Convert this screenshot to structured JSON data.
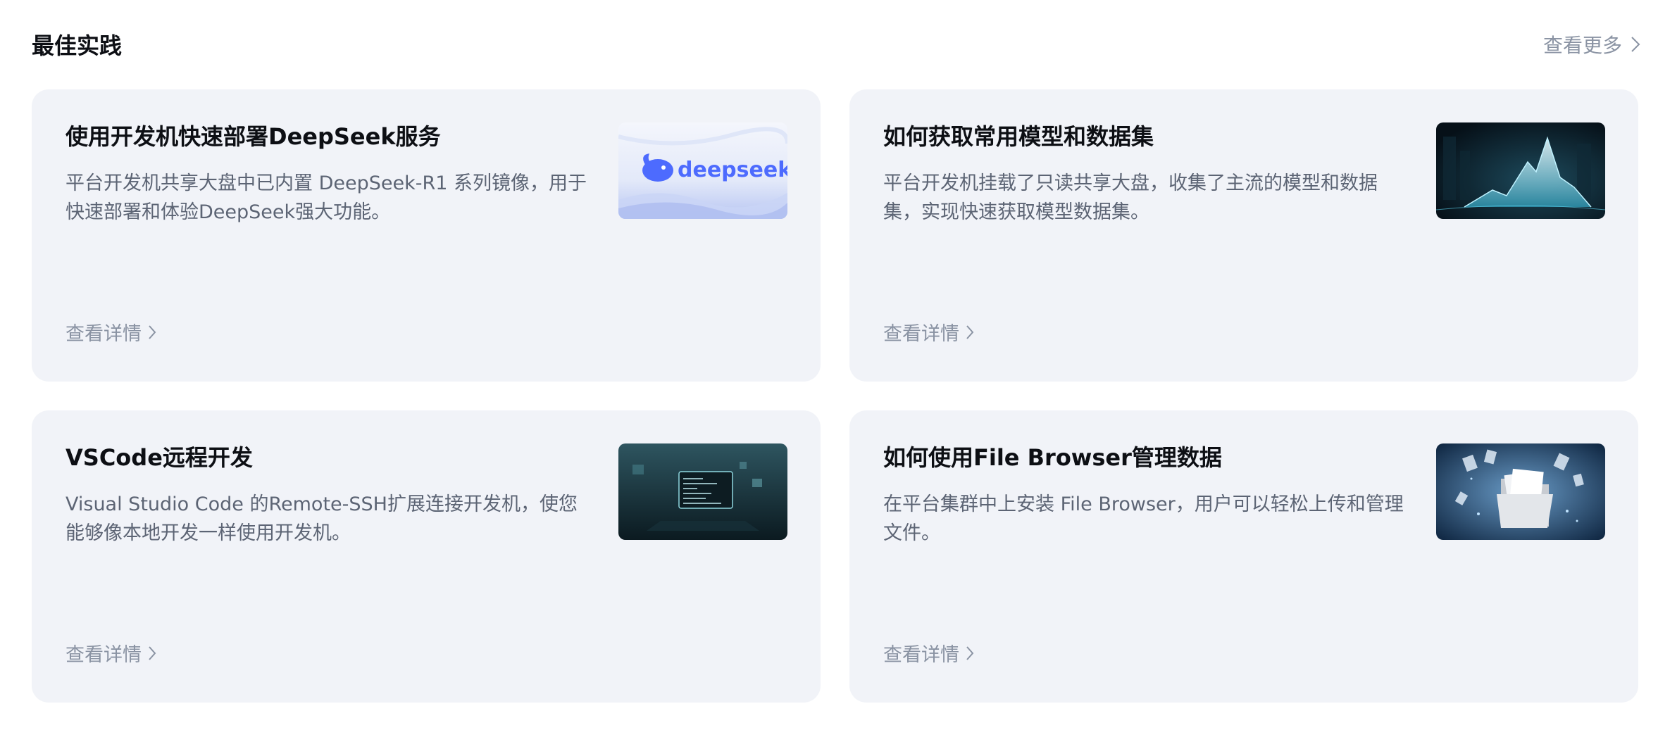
{
  "section": {
    "title": "最佳实践",
    "more_label": "查看更多"
  },
  "cards": [
    {
      "title": "使用开发机快速部署DeepSeek服务",
      "description": "平台开发机共享大盘中已内置 DeepSeek-R1 系列镜像，用于快速部署和体验DeepSeek强大功能。",
      "link_label": "查看详情",
      "thumb_icon": "deepseek-logo-thumbnail",
      "thumb_text": "deepseek"
    },
    {
      "title": "如何获取常用模型和数据集",
      "description": "平台开发机挂载了只读共享大盘，收集了主流的模型和数据集，实现快速获取模型数据集。",
      "link_label": "查看详情",
      "thumb_icon": "data-peaks-thumbnail"
    },
    {
      "title": "VSCode远程开发",
      "description": "Visual Studio Code 的Remote-SSH扩展连接开发机，使您能够像本地开发一样使用开发机。",
      "link_label": "查看详情",
      "thumb_icon": "code-screen-thumbnail"
    },
    {
      "title": "如何使用File Browser管理数据",
      "description": "在平台集群中上安装 File Browser，用户可以轻松上传和管理文件。",
      "link_label": "查看详情",
      "thumb_icon": "folder-files-thumbnail"
    }
  ],
  "colors": {
    "card_bg": "#f1f3f8",
    "title": "#0d0f14",
    "desc": "#5c6474",
    "muted": "#8a93a3",
    "deepseek_blue": "#4d6bfe"
  }
}
